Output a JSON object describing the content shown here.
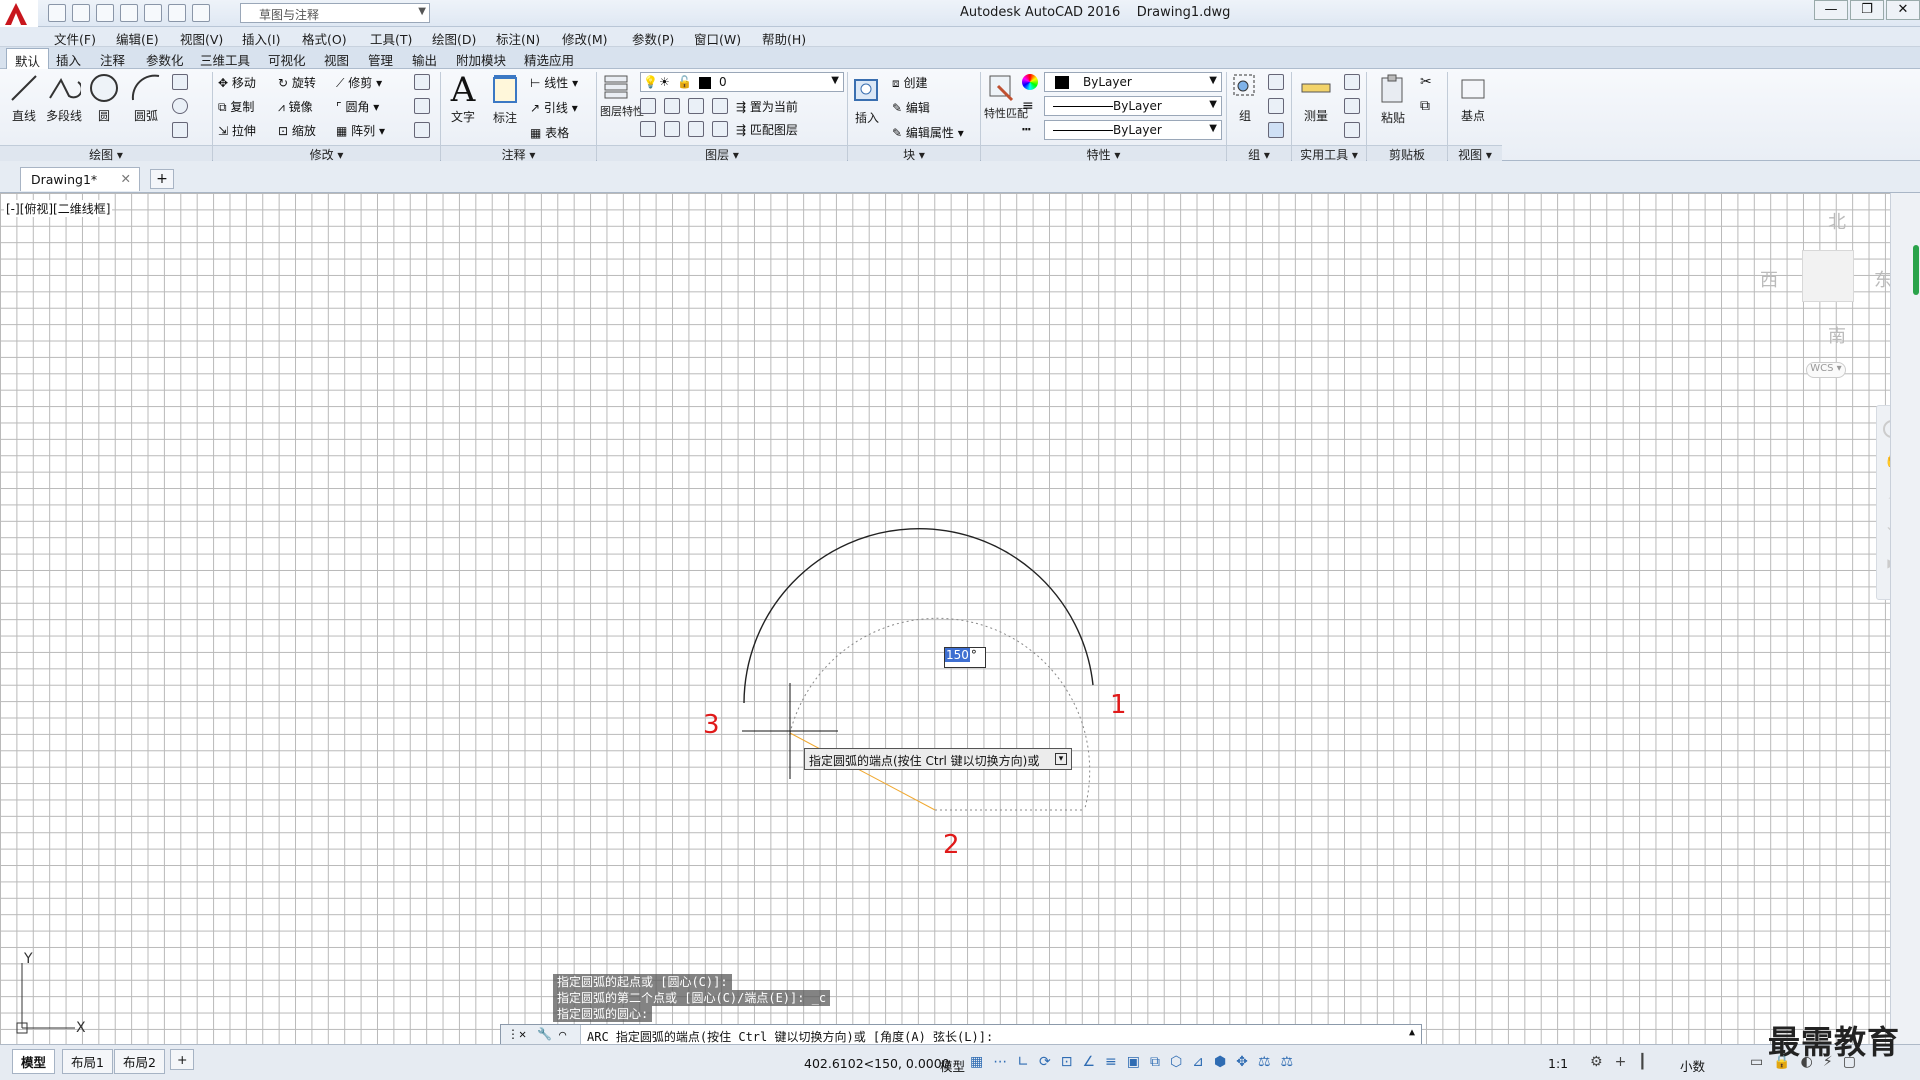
{
  "app": {
    "title": "Autodesk AutoCAD 2016",
    "document": "Drawing1.dwg",
    "workspace": "草图与注释"
  },
  "menu": [
    "文件(F)",
    "编辑(E)",
    "视图(V)",
    "插入(I)",
    "格式(O)",
    "工具(T)",
    "绘图(D)",
    "标注(N)",
    "修改(M)",
    "参数(P)",
    "窗口(W)",
    "帮助(H)"
  ],
  "ribbon_tabs": [
    "默认",
    "插入",
    "注释",
    "参数化",
    "三维工具",
    "可视化",
    "视图",
    "管理",
    "输出",
    "附加模块",
    "精选应用"
  ],
  "ribbon": {
    "draw": {
      "line": "直线",
      "polyline": "多段线",
      "circle": "圆",
      "arc": "圆弧",
      "title": "绘图"
    },
    "modify": {
      "move": "移动",
      "rotate": "旋转",
      "trim": "修剪",
      "copy": "复制",
      "mirror": "镜像",
      "fillet": "圆角",
      "stretch": "拉伸",
      "scale": "缩放",
      "array": "阵列",
      "title": "修改"
    },
    "annotation": {
      "text": "文字",
      "dim": "标注",
      "linear": "线性",
      "leader": "引线",
      "table": "表格",
      "title": "注释"
    },
    "layers": {
      "props": "图层特性",
      "current_layer": "0",
      "set_current": "置为当前",
      "match_layer": "匹配图层",
      "title": "图层"
    },
    "block": {
      "insert": "插入",
      "create": "创建",
      "edit": "编辑",
      "edit_attr": "编辑属性",
      "title": "块"
    },
    "properties": {
      "match": "特性匹配",
      "color": "ByLayer",
      "linetype": "ByLayer",
      "lineweight": "ByLayer",
      "title": "特性"
    },
    "groups": {
      "group": "组",
      "title": "组"
    },
    "utilities": {
      "measure": "测量",
      "title": "实用工具"
    },
    "clipboard": {
      "paste": "粘贴",
      "title": "剪贴板"
    },
    "view": {
      "base": "基点",
      "title": "视图"
    }
  },
  "doc_tab": {
    "name": "Drawing1*"
  },
  "viewport": {
    "label": "[-][俯视][二维线框]",
    "viewcube": {
      "north": "北",
      "south": "南",
      "east": "东",
      "west": "西",
      "wcs": "WCS"
    },
    "markers": [
      "1",
      "2",
      "3"
    ],
    "dynamic_input": "150",
    "dynamic_unit": "°",
    "tooltip": "指定圆弧的端点(按住 Ctrl 键以切换方向)或"
  },
  "command": {
    "history": [
      "指定圆弧的起点或 [圆心(C)]:",
      "指定圆弧的第二个点或 [圆心(C)/端点(E)]: _c",
      "指定圆弧的圆心:"
    ],
    "prompt": "ARC 指定圆弧的端点(按住 Ctrl 键以切换方向)或 [角度(A) 弦长(L)]:"
  },
  "layout_tabs": [
    "模型",
    "布局1",
    "布局2"
  ],
  "status": {
    "coordinates": "402.6102<150, 0.0000",
    "mode": "模型",
    "scale": "1:1",
    "units": "小数"
  },
  "watermark": "最需教育"
}
